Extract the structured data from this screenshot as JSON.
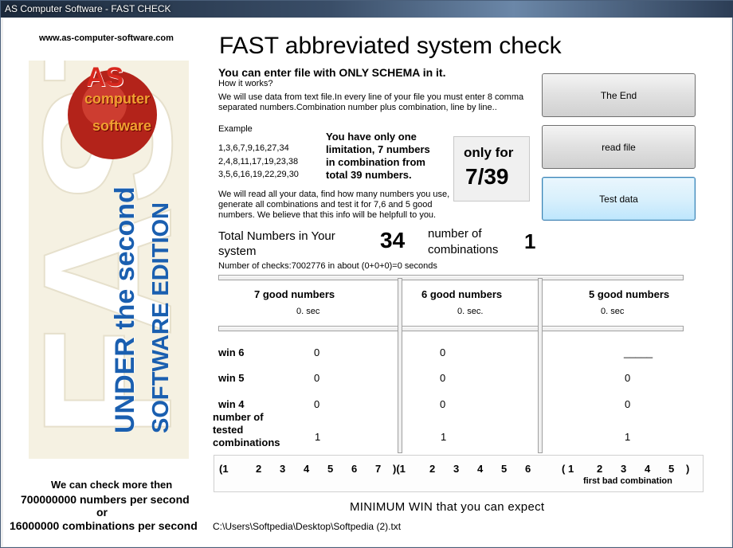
{
  "window": {
    "title": "AS Computer Software - FAST CHECK"
  },
  "left": {
    "url": "www.as-computer-software.com",
    "logo_brand": "AS computer software",
    "logo_big": "FAST",
    "logo_line1": "UNDER the second",
    "logo_line2": "SOFTWARE EDITION",
    "speed1": "We can check more then",
    "speed2": "700000000 numbers per second",
    "speed3": "or",
    "speed4": "16000000 combinations per second"
  },
  "main": {
    "title": "FAST abbreviated system check",
    "subtitle": "You can enter file with ONLY SCHEMA in it.",
    "how": "How it works?",
    "desc1": "We will use data from text file.In every line of your file you must enter 8 comma",
    "desc2": "separated numbers.Combination number plus combination, line by line..",
    "example_label": "Example",
    "examples": [
      "1,3,6,7,9,16,27,34",
      "2,4,8,11,17,19,23,38",
      "3,5,6,16,19,22,29,30"
    ],
    "limit1": "You have only one",
    "limit2": "limitation, 7 numbers",
    "limit3": "in combination from",
    "limit4": "total 39 numbers.",
    "only_for": "only for",
    "ratio": "7/39",
    "read1": "We will read all your data, find how many numbers you use,",
    "read2": "generate all combinations  and test it for 7,6 and 5 good",
    "read3": "numbers. We believe that this info will be helpfull to you."
  },
  "buttons": {
    "end": "The End",
    "read": "read file",
    "test": "Test data"
  },
  "stats": {
    "total_label1": "Total Numbers in Your",
    "total_label2": "system",
    "total_value": "34",
    "comb_label1": "number of",
    "comb_label2": "combinations",
    "comb_value": "1",
    "checks": "Number of checks:7002776  in about (0+0+0)=0 seconds"
  },
  "results": {
    "cols": [
      {
        "title": "7 good numbers",
        "time": "0. sec"
      },
      {
        "title": "6 good numbers",
        "time": "0. sec."
      },
      {
        "title": "5 good numbers",
        "time": "0. sec"
      }
    ],
    "rows": [
      {
        "label": "win 6",
        "v": [
          "0",
          "0",
          "_____"
        ]
      },
      {
        "label": "win 5",
        "v": [
          "0",
          "0",
          "0"
        ]
      },
      {
        "label": "win 4",
        "v": [
          "0",
          "0",
          "0"
        ]
      }
    ],
    "tested_label1": "number of",
    "tested_label2": "tested",
    "tested_label3": "combinations",
    "tested": [
      "1",
      "1",
      "1"
    ]
  },
  "combos": {
    "open7": "(1",
    "seq7": [
      "2",
      "3",
      "4",
      "5",
      "6",
      "7"
    ],
    "close7": ")(1",
    "seq6": [
      "2",
      "3",
      "4",
      "5",
      "6"
    ],
    "open5": "( 1",
    "seq5": [
      "2",
      "3",
      "4",
      "5"
    ],
    "close5": ")",
    "bad_label": "first bad combination"
  },
  "footer": {
    "minimum": "MINIMUM WIN that you can expect",
    "path": "C:\\Users\\Softpedia\\Desktop\\Softpedia (2).txt"
  },
  "colors": {
    "logo_blue": "#1f5fb5",
    "logo_red": "#c0281e"
  }
}
